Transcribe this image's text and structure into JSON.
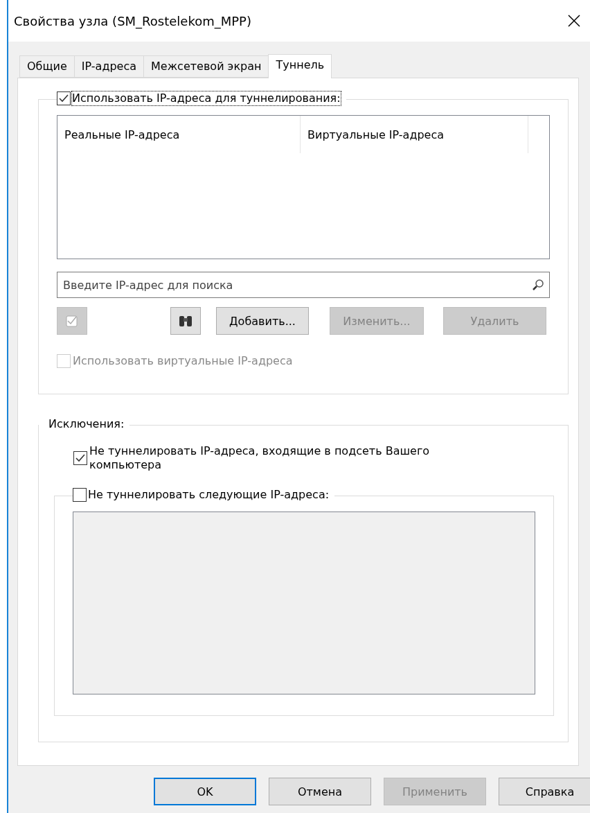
{
  "window": {
    "title": "Свойства узла (SM_Rostelekom_MPP)"
  },
  "tabs": [
    {
      "label": "Общие",
      "selected": false
    },
    {
      "label": "IP-адреса",
      "selected": false
    },
    {
      "label": "Межсетевой экран",
      "selected": false
    },
    {
      "label": "Туннель",
      "selected": true
    }
  ],
  "tunnel": {
    "use_ip": {
      "label": "Использовать IP-адреса для туннелирования:",
      "checked": true
    },
    "table": {
      "columns": [
        "Реальные IP-адреса",
        "Виртуальные IP-адреса"
      ]
    },
    "search": {
      "placeholder": "Введите IP-адрес для поиска"
    },
    "buttons": [
      {
        "kind": "check",
        "disabled": true
      },
      {
        "kind": "binoculars",
        "disabled": false
      },
      {
        "kind": "text",
        "label": "Добавить...",
        "disabled": false
      },
      {
        "kind": "text",
        "label": "Изменить...",
        "disabled": true
      },
      {
        "kind": "text",
        "label": "Удалить",
        "disabled": true
      }
    ],
    "use_virtual": {
      "label": "Использовать виртуальные IP-адреса",
      "checked": false,
      "disabled": true
    }
  },
  "exceptions": {
    "title": "Исключения:",
    "subnet": {
      "label": "Не туннелировать IP-адреса, входящие в подсеть Вашего компьютера",
      "checked": true
    },
    "list": {
      "label": "Не туннелировать следующие IP-адреса:",
      "checked": false
    }
  },
  "footer": [
    {
      "label": "OK",
      "default": true,
      "disabled": false
    },
    {
      "label": "Отмена",
      "default": false,
      "disabled": false
    },
    {
      "label": "Применить",
      "default": false,
      "disabled": true
    },
    {
      "label": "Справка",
      "default": false,
      "disabled": false
    }
  ]
}
